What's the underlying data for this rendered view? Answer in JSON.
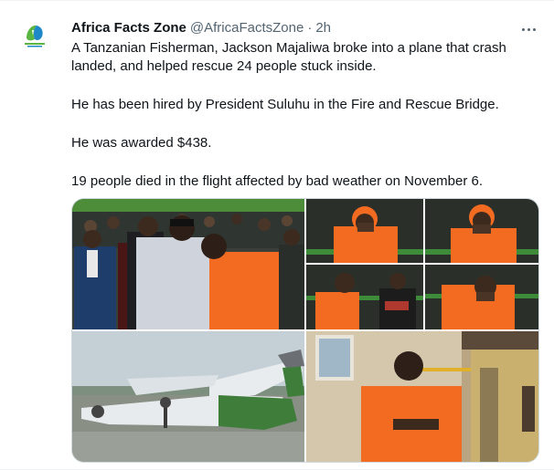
{
  "tweet": {
    "display_name": "Africa Facts Zone",
    "handle": "@AfricaFactsZone",
    "separator": "·",
    "time": "2h",
    "paragraphs": [
      "A Tanzanian Fisherman, Jackson Majaliwa broke into a plane that crash",
      "landed, and helped rescue 24 people stuck inside.",
      "He has been hired by President Suluhu in the Fire and Rescue Bridge.",
      "He was awarded $438.",
      "19 people died in the flight affected by bad weather on November 6."
    ],
    "avatar_text": "Africa Facts Zone"
  },
  "colors": {
    "text": "#0f1419",
    "secondary": "#536471",
    "border": "#cfd9de",
    "avatar_green": "#5bb543",
    "avatar_blue": "#1e88c9",
    "orange": "#f26b21"
  },
  "icons": {
    "more": "ellipsis-horizontal-icon",
    "avatar": "africa-facts-zone-logo"
  }
}
